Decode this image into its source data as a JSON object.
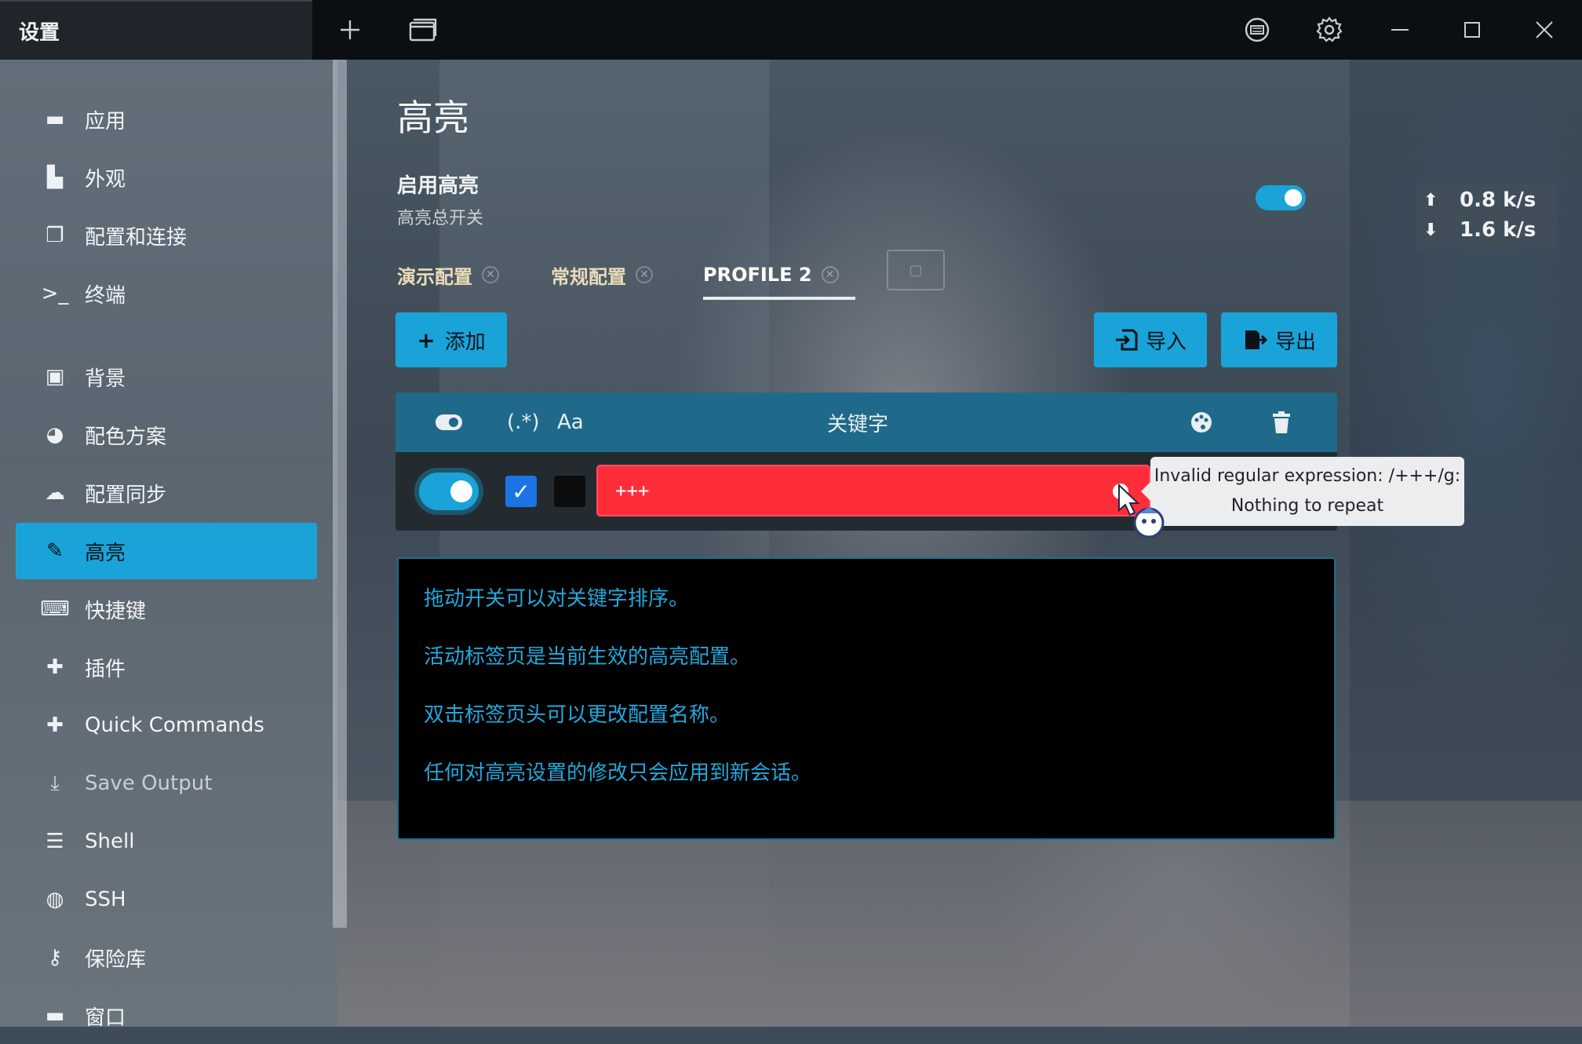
{
  "window": {
    "tab_title": "设置",
    "buttons": {
      "new_tab": "+",
      "tabs": "⧉",
      "keyboard": "⌨",
      "settings": "⚙",
      "minimize": "—",
      "maximize": "☐",
      "close": "✕"
    }
  },
  "sidebar": {
    "items": [
      {
        "label": "应用",
        "icon": "app-icon",
        "glyph": "▬"
      },
      {
        "label": "外观",
        "icon": "appearance-icon",
        "glyph": "▙"
      },
      {
        "label": "配置和连接",
        "icon": "profiles-icon",
        "glyph": "❐"
      },
      {
        "label": "终端",
        "icon": "terminal-icon",
        "glyph": ">_"
      },
      {
        "label": "背景",
        "icon": "image-icon",
        "glyph": "▣"
      },
      {
        "label": "配色方案",
        "icon": "palette-icon",
        "glyph": "◕"
      },
      {
        "label": "配置同步",
        "icon": "cloud-icon",
        "glyph": "☁"
      },
      {
        "label": "高亮",
        "icon": "highlighter-icon",
        "glyph": "✎",
        "active": true
      },
      {
        "label": "快捷键",
        "icon": "keyboard-icon",
        "glyph": "⌨"
      },
      {
        "label": "插件",
        "icon": "puzzle-icon",
        "glyph": "✚"
      },
      {
        "label": "Quick Commands",
        "icon": "puzzle-icon",
        "glyph": "✚"
      },
      {
        "label": "Save Output",
        "icon": "download-icon",
        "glyph": "⤓"
      },
      {
        "label": "Shell",
        "icon": "list-icon",
        "glyph": "☰"
      },
      {
        "label": "SSH",
        "icon": "globe-icon",
        "glyph": "◍"
      },
      {
        "label": "保险库",
        "icon": "key-icon",
        "glyph": "⚷"
      },
      {
        "label": "窗口",
        "icon": "window-icon",
        "glyph": "▬"
      }
    ]
  },
  "main": {
    "title": "高亮",
    "enable": {
      "label": "启用高亮",
      "sub": "高亮总开关",
      "on": true
    },
    "tabs": [
      {
        "label": "演示配置"
      },
      {
        "label": "常规配置"
      },
      {
        "label": "PROFILE 2",
        "active": true
      }
    ],
    "buttons": {
      "add": "添加",
      "import": "导入",
      "export": "导出"
    },
    "table": {
      "header": {
        "regex": "(.*)",
        "case": "Aa",
        "keyword": "关键字"
      },
      "rows": [
        {
          "enabled": true,
          "regex": true,
          "color": "#0a0c0e",
          "keyword": "+++"
        }
      ]
    },
    "tooltip": {
      "line1": "Invalid regular expression: /+++/g:",
      "line2": "Nothing to repeat"
    },
    "help": [
      "拖动开关可以对关键字排序。",
      "活动标签页是当前生效的高亮配置。",
      "双击标签页头可以更改配置名称。",
      "任何对高亮设置的修改只会应用到新会话。"
    ]
  },
  "netspeed": {
    "up": "0.8 k/s",
    "down": "1.6 k/s"
  },
  "colors": {
    "accent": "#1aa3d9",
    "error": "#ff2d3a",
    "tableHeader": "#1f6a8a"
  }
}
